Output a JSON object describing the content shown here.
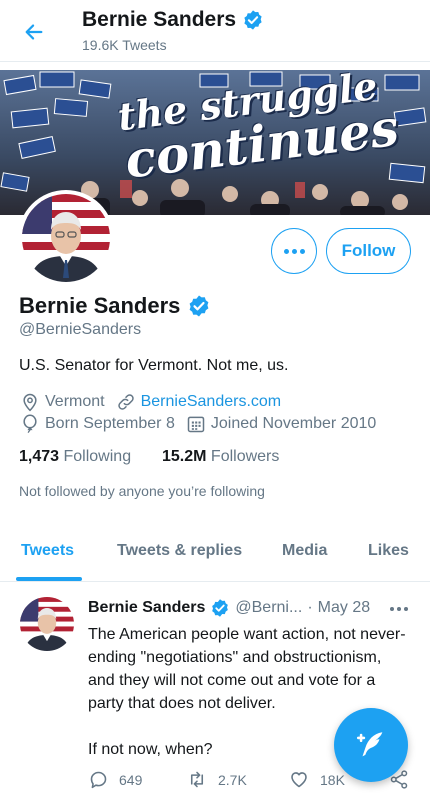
{
  "header": {
    "name": "Bernie Sanders",
    "tweet_count": "19.6K Tweets",
    "back_icon": "arrow-left-icon"
  },
  "banner": {
    "line1": "the struggle",
    "line2": "continues"
  },
  "profile": {
    "name": "Bernie Sanders",
    "handle": "@BernieSanders",
    "bio": "U.S. Senator for Vermont. Not me, us.",
    "location": "Vermont",
    "website": "BernieSanders.com",
    "birthday": "Born September 8",
    "joined": "Joined November 2010",
    "following_count": "1,473",
    "following_label": "Following",
    "followers_count": "15.2M",
    "followers_label": "Followers",
    "not_followed": "Not followed by anyone you’re following",
    "follow_label": "Follow"
  },
  "tabs": [
    {
      "label": "Tweets",
      "active": true
    },
    {
      "label": "Tweets & replies",
      "active": false
    },
    {
      "label": "Media",
      "active": false
    },
    {
      "label": "Likes",
      "active": false
    }
  ],
  "tweet": {
    "name": "Bernie Sanders",
    "handle": "@Berni...",
    "separator": "·",
    "date": "May 28",
    "text": "The American people want action, not never-ending \"negotiations\" and obstructionism, and they will not come out and vote for a party that does not deliver.\n\nIf not now, when?",
    "replies": "649",
    "retweets": "2.7K",
    "likes": "18K"
  },
  "colors": {
    "accent": "#1da1f2",
    "text": "#14171a",
    "muted": "#657786"
  }
}
